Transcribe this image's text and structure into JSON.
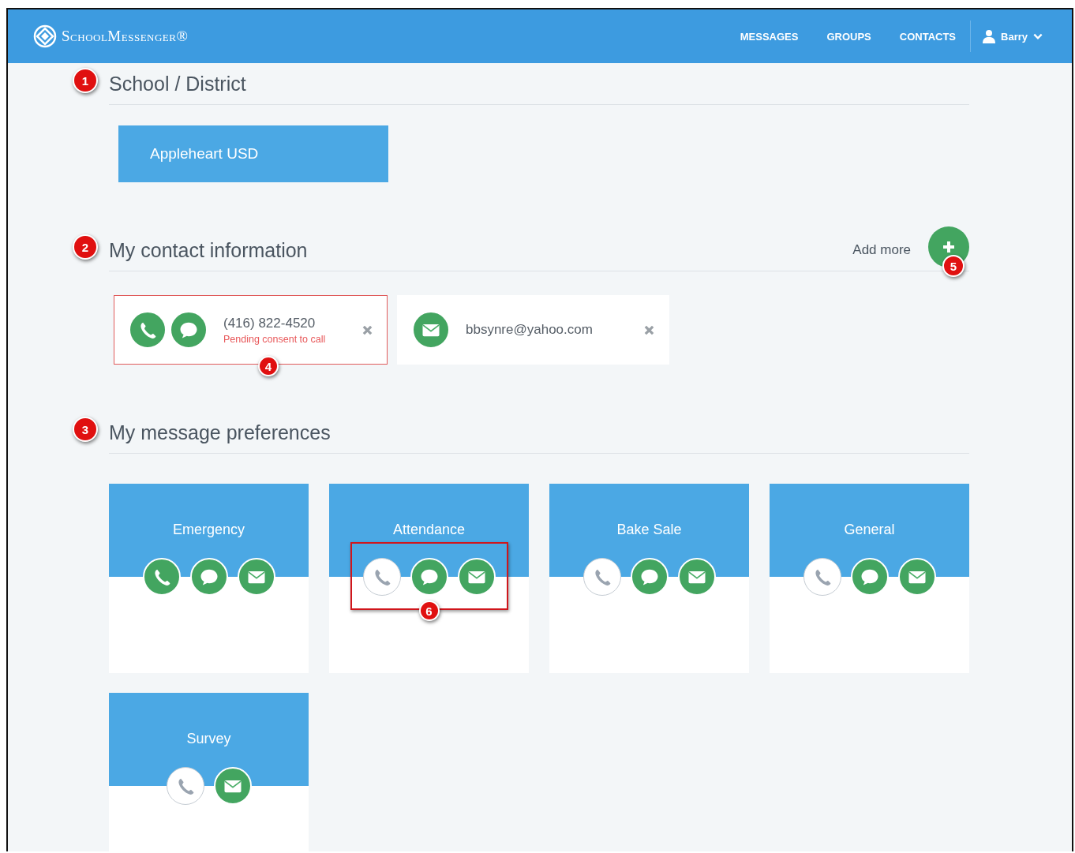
{
  "header": {
    "logo": "SchoolMessenger®",
    "nav": [
      {
        "label": "MESSAGES"
      },
      {
        "label": "GROUPS"
      },
      {
        "label": "CONTACTS"
      }
    ],
    "user": "Barry"
  },
  "school_section": {
    "callout": "1",
    "title": "School / District",
    "schools": [
      "Appleheart USD"
    ]
  },
  "contact_section": {
    "callout": "2",
    "title": "My contact information",
    "add_more": "Add more",
    "add_callout": "5",
    "contacts": [
      {
        "kind": "phone",
        "value": "(416) 822-4520",
        "note": "Pending consent to call",
        "highlighted": true,
        "callout": "4",
        "channels": [
          {
            "kind": "phone",
            "on": true
          },
          {
            "kind": "sms",
            "on": true
          }
        ]
      },
      {
        "kind": "email",
        "value": "bbsynre@yahoo.com",
        "highlighted": false,
        "channels": [
          {
            "kind": "email",
            "on": true
          }
        ]
      }
    ]
  },
  "preference_section": {
    "callout": "3",
    "title": "My message preferences",
    "preferences": [
      {
        "name": "Emergency",
        "highlighted": false,
        "channels": [
          {
            "kind": "phone",
            "on": true
          },
          {
            "kind": "sms",
            "on": true
          },
          {
            "kind": "email",
            "on": true
          }
        ]
      },
      {
        "name": "Attendance",
        "highlighted": true,
        "callout": "6",
        "channels": [
          {
            "kind": "phone",
            "on": false
          },
          {
            "kind": "sms",
            "on": true
          },
          {
            "kind": "email",
            "on": true
          }
        ]
      },
      {
        "name": "Bake Sale",
        "highlighted": false,
        "channels": [
          {
            "kind": "phone",
            "on": false
          },
          {
            "kind": "sms",
            "on": true
          },
          {
            "kind": "email",
            "on": true
          }
        ]
      },
      {
        "name": "General",
        "highlighted": false,
        "channels": [
          {
            "kind": "phone",
            "on": false
          },
          {
            "kind": "sms",
            "on": true
          },
          {
            "kind": "email",
            "on": true
          }
        ]
      },
      {
        "name": "Survey",
        "highlighted": false,
        "channels": [
          {
            "kind": "phone",
            "on": false
          },
          {
            "kind": "email",
            "on": true
          }
        ]
      }
    ]
  }
}
